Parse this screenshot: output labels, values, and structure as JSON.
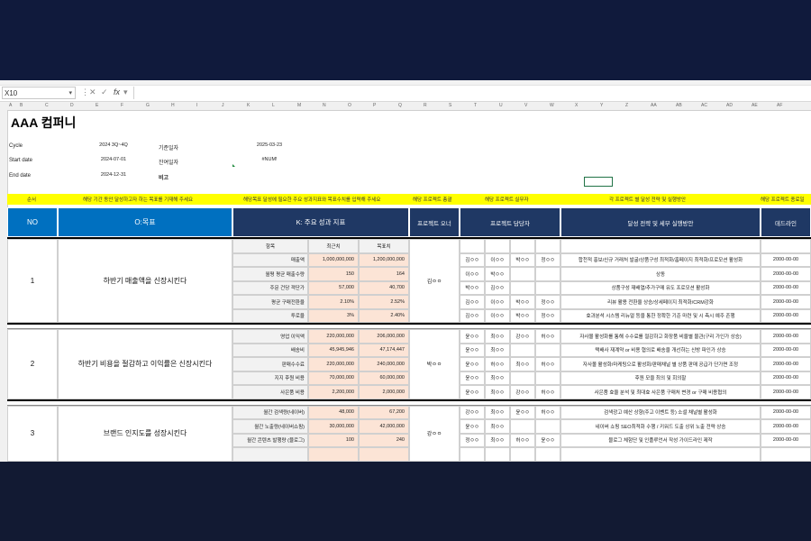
{
  "toolbar": {
    "name_box": "X10",
    "fx_label": "fx",
    "cancel_icon": "close-icon",
    "confirm_icon": "check-icon"
  },
  "columns": [
    "A",
    "B",
    "C",
    "D",
    "E",
    "F",
    "G",
    "H",
    "I",
    "J",
    "K",
    "L",
    "M",
    "N",
    "O",
    "P",
    "Q",
    "R",
    "S",
    "T",
    "U",
    "V",
    "W",
    "X",
    "Y",
    "Z",
    "AA",
    "AB",
    "AC",
    "AD",
    "AE",
    "AF"
  ],
  "company": "AAA 컴퍼니",
  "meta": {
    "cycle_label": "Cycle",
    "cycle_value": "2024 3Q~4Q",
    "start_label": "Start date",
    "start_value": "2024-07-01",
    "end_label": "End date",
    "end_value": "2024-12-31",
    "base_date_label": "기준일자",
    "base_date_value": "2025-03-23",
    "remain_label": "잔여일자",
    "remain_value": "#NUM!",
    "note_label": "비고"
  },
  "guide": {
    "g1": "순서",
    "g2": "해당 기간 동안 달성하고자 하는 목표를 기재해 주세요",
    "g3": "해당목표 달성에 필요한 주요 성과지표와 목표수치를 입력해 주세요",
    "g4": "해당 프로젝트 총괄",
    "g5": "해당 프로젝트 실무자",
    "g6": "각 프로젝트 별 달성 전략 및 실행방안",
    "g7": "해당 프로젝트 종료일"
  },
  "headers": {
    "no": "NO",
    "objective": "O:목표",
    "kpi": "K: 주요 성과 지표",
    "owner": "프로젝트 오너",
    "assignee": "프로젝트 담당자",
    "strategy": "달성 전략 및 세부 실행방안",
    "deadline": "데드라인",
    "sub_item": "항목",
    "sub_current": "최근치",
    "sub_target": "목표치"
  },
  "blocks": [
    {
      "no": "1",
      "objective": "하반기 매출액을 신장시킨다",
      "owner": "김ㅇㅇ",
      "rows": [
        {
          "item": "항목",
          "current": "최근치",
          "target": "목표치",
          "a": [
            "",
            "",
            "",
            ""
          ],
          "plan": "",
          "deadline": "",
          "header": true
        },
        {
          "item": "매출액",
          "current": "1,000,000,000",
          "target": "1,200,000,000",
          "a": [
            "김ㅇㅇ",
            "이ㅇㅇ",
            "박ㅇㅇ",
            "정ㅇㅇ"
          ],
          "plan": "합천적 홍보/신규 거래처 발굴/상품구성 최적화/홈페이지 최적화/프로모션 활성화",
          "deadline": "2000-00-00"
        },
        {
          "item": "월평 평균 매출수량",
          "current": "150",
          "target": "164",
          "a": [
            "이ㅇㅇ",
            "박ㅇㅇ",
            "",
            ""
          ],
          "plan": "상동",
          "deadline": "2000-00-00"
        },
        {
          "item": "주문 건당 객단가",
          "current": "57,000",
          "target": "40,700",
          "a": [
            "박ㅇㅇ",
            "김ㅇㅇ",
            "",
            ""
          ],
          "plan": "상품구성 재배열/추가구매 유도 프로모션 활성화",
          "deadline": "2000-00-00"
        },
        {
          "item": "평균 구매전환율",
          "current": "2.10%",
          "target": "2.52%",
          "a": [
            "김ㅇㅇ",
            "이ㅇㅇ",
            "박ㅇㅇ",
            "정ㅇㅇ"
          ],
          "plan": "리뷰 활용 전환율 상승/상세페이지 최적화/CRM강화",
          "deadline": "2000-00-00"
        },
        {
          "item": "투로율",
          "current": "3%",
          "target": "2.40%",
          "a": [
            "김ㅇㅇ",
            "이ㅇㅇ",
            "박ㅇㅇ",
            "정ㅇㅇ"
          ],
          "plan": "효과분석 시스템 리뉴얼 등을 통한 정확한 기준 마련 및 시 측시 예주 존행",
          "deadline": "2000-00-00"
        }
      ]
    },
    {
      "no": "2",
      "objective": "하반기 비용을 절감하고 이익률은 신장시킨다",
      "owner": "박ㅇㅇ",
      "rows": [
        {
          "item": "영업 이익액",
          "current": "220,000,000",
          "target": "206,000,000",
          "a": [
            "윤ㅇㅇ",
            "최ㅇㅇ",
            "강ㅇㅇ",
            "허ㅇㅇ"
          ],
          "plan": "자사몰 활성화를 통해 수수료를 절감하고 화장품 비율별 물관(구리 가인가 상승)",
          "deadline": "2000-00-00"
        },
        {
          "item": "배송비",
          "current": "45,945,946",
          "target": "47,174,447",
          "a": [
            "윤ㅇㅇ",
            "최ㅇㅇ",
            "",
            ""
          ],
          "plan": "택배사 재계약 or 비용 협의로 배송을 개선하는 신방 파인가 상승",
          "deadline": "2000-00-00"
        },
        {
          "item": "판매수수료",
          "current": "220,000,000",
          "target": "240,000,000",
          "a": [
            "윤ㅇㅇ",
            "허ㅇㅇ",
            "최ㅇㅇ",
            "허ㅇㅇ"
          ],
          "plan": "자사몰 활성화/마케팅으로 활성화/판매채널 별 상품 판매 공급가 단가면 조정",
          "deadline": "2000-00-00"
        },
        {
          "item": "지지 후원 비용",
          "current": "70,000,000",
          "target": "60,000,000",
          "a": [
            "윤ㅇㅇ",
            "최ㅇㅇ",
            "",
            ""
          ],
          "plan": "후원 모을 최의 및 회의찰",
          "deadline": "2000-00-00"
        },
        {
          "item": "사은품 비용",
          "current": "2,200,000",
          "target": "2,000,000",
          "a": [
            "윤ㅇㅇ",
            "최ㅇㅇ",
            "강ㅇㅇ",
            "허ㅇㅇ"
          ],
          "plan": "사은품 효율 분석 및 최대효 사은품 구매처 변경 or 구매 비용협의",
          "deadline": "2000-00-00"
        }
      ]
    },
    {
      "no": "3",
      "objective": "브랜드 인지도를 성장시킨다",
      "owner": "강ㅇㅇ",
      "rows": [
        {
          "item": "월간 검색량(네이버)",
          "current": "48,000",
          "target": "67,200",
          "a": [
            "강ㅇㅇ",
            "최ㅇㅇ",
            "윤ㅇㅇ",
            "허ㅇㅇ"
          ],
          "plan": "검색광고 예산 상향(주고 이벤트 등) 소셜 채널별 활성화",
          "deadline": "2000-00-00"
        },
        {
          "item": "월간 노출량(네이버쇼핑)",
          "current": "30,000,000",
          "target": "42,000,000",
          "a": [
            "윤ㅇㅇ",
            "최ㅇㅇ",
            "",
            ""
          ],
          "plan": "네이버 쇼핑 SEO최적화 수행 / 키워드 도출 상위 노출 전략 상승",
          "deadline": "2000-00-00"
        },
        {
          "item": "월간 콘텐츠 발행량 (블로그)",
          "current": "100",
          "target": "240",
          "a": [
            "정ㅇㅇ",
            "최ㅇㅇ",
            "허ㅇㅇ",
            "윤ㅇㅇ"
          ],
          "plan": "블로그 체험단 및 인플루언서 작성 가이드라인 제작",
          "deadline": "2000-00-00"
        },
        {
          "item": "",
          "current": "",
          "target": "",
          "a": [
            "",
            "",
            "",
            ""
          ],
          "plan": "",
          "deadline": ""
        }
      ]
    }
  ]
}
